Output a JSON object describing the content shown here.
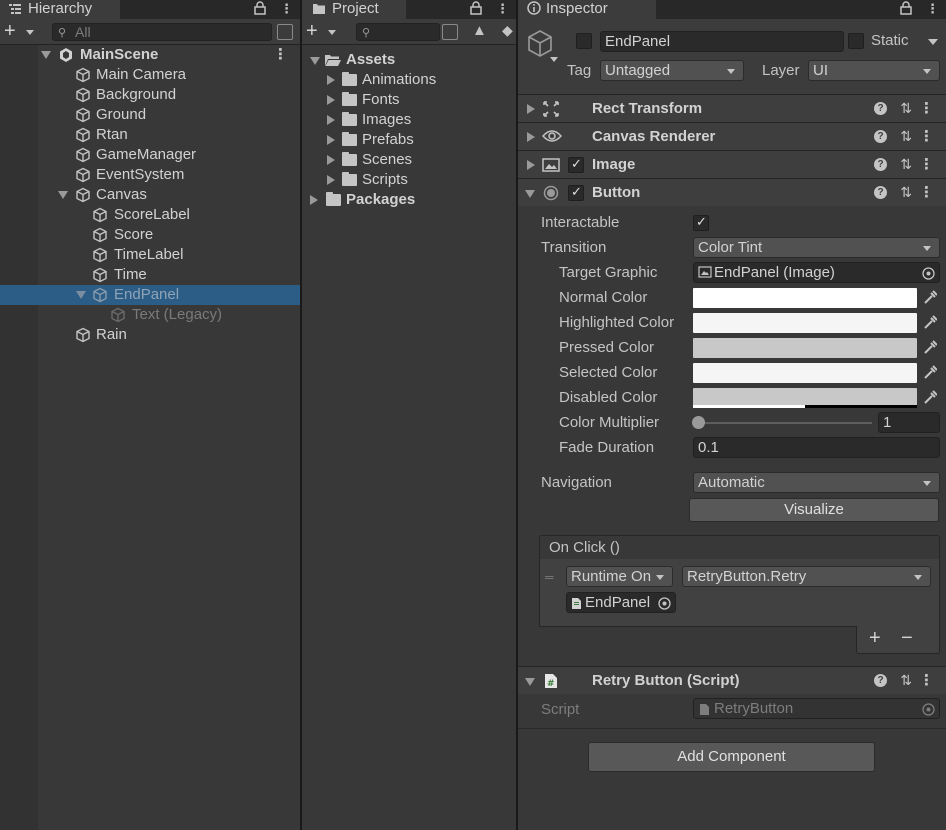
{
  "hierarchy": {
    "tab_label": "Hierarchy",
    "search_placeholder": "All",
    "scene_name": "MainScene",
    "items": [
      {
        "label": "Main Camera"
      },
      {
        "label": "Background"
      },
      {
        "label": "Ground"
      },
      {
        "label": "Rtan"
      },
      {
        "label": "GameManager"
      },
      {
        "label": "EventSystem"
      },
      {
        "label": "Canvas"
      },
      {
        "label": "ScoreLabel"
      },
      {
        "label": "Score"
      },
      {
        "label": "TimeLabel"
      },
      {
        "label": "Time"
      },
      {
        "label": "EndPanel"
      },
      {
        "label": "Text (Legacy)"
      },
      {
        "label": "Rain"
      }
    ]
  },
  "project": {
    "tab_label": "Project",
    "assets_label": "Assets",
    "folders": [
      {
        "label": "Animations"
      },
      {
        "label": "Fonts"
      },
      {
        "label": "Images"
      },
      {
        "label": "Prefabs"
      },
      {
        "label": "Scenes"
      },
      {
        "label": "Scripts"
      }
    ],
    "packages_label": "Packages"
  },
  "inspector": {
    "tab_label": "Inspector",
    "object_name": "EndPanel",
    "static_label": "Static",
    "tag_label": "Tag",
    "tag_value": "Untagged",
    "layer_label": "Layer",
    "layer_value": "UI",
    "components": {
      "rect_transform": "Rect Transform",
      "canvas_renderer": "Canvas Renderer",
      "image": "Image",
      "button": "Button",
      "retry_script": "Retry Button (Script)"
    },
    "button": {
      "interactable_label": "Interactable",
      "transition_label": "Transition",
      "transition_value": "Color Tint",
      "target_graphic_label": "Target Graphic",
      "target_graphic_value": "EndPanel (Image)",
      "normal_color_label": "Normal Color",
      "highlighted_color_label": "Highlighted Color",
      "pressed_color_label": "Pressed Color",
      "selected_color_label": "Selected Color",
      "disabled_color_label": "Disabled Color",
      "color_multiplier_label": "Color Multiplier",
      "color_multiplier_value": "1",
      "fade_duration_label": "Fade Duration",
      "fade_duration_value": "0.1",
      "navigation_label": "Navigation",
      "navigation_value": "Automatic",
      "visualize_label": "Visualize",
      "on_click_label": "On Click ()",
      "runtime_value": "Runtime On",
      "function_value": "RetryButton.Retry",
      "object_value": "EndPanel",
      "add_symbol": "+",
      "remove_symbol": "−"
    },
    "script": {
      "script_label": "Script",
      "script_value": "RetryButton"
    },
    "add_component_label": "Add Component",
    "colors": {
      "normal": "#ffffff",
      "highlighted": "#f5f5f5",
      "pressed": "#c8c8c8",
      "selected": "#f5f5f5",
      "disabled": "#c8c8c8"
    }
  },
  "colors": {
    "selection": "#2c5d87",
    "panel_bg": "#383838"
  }
}
